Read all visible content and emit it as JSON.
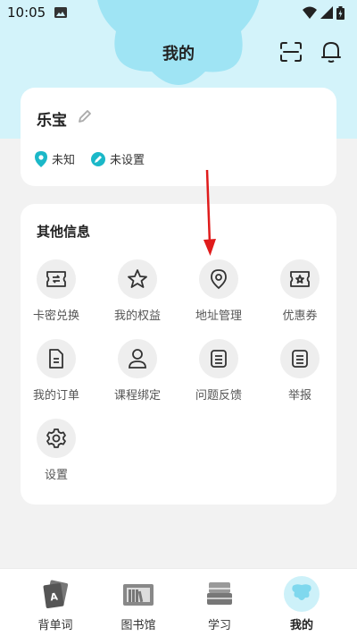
{
  "status_bar": {
    "time": "10:05"
  },
  "header": {
    "title": "我的"
  },
  "profile": {
    "name": "乐宝",
    "location": "未知",
    "setting": "未设置"
  },
  "other_info": {
    "title": "其他信息",
    "items": [
      {
        "label": "卡密兑换",
        "icon": "ticket-exchange-icon"
      },
      {
        "label": "我的权益",
        "icon": "star-icon"
      },
      {
        "label": "地址管理",
        "icon": "location-pin-icon"
      },
      {
        "label": "优惠券",
        "icon": "coupon-icon"
      },
      {
        "label": "我的订单",
        "icon": "order-document-icon"
      },
      {
        "label": "课程绑定",
        "icon": "person-icon"
      },
      {
        "label": "问题反馈",
        "icon": "feedback-document-icon"
      },
      {
        "label": "举报",
        "icon": "report-document-icon"
      },
      {
        "label": "设置",
        "icon": "gear-icon"
      }
    ]
  },
  "bottom_nav": {
    "items": [
      {
        "label": "背单词",
        "icon": "flashcard-icon"
      },
      {
        "label": "图书馆",
        "icon": "bookshelf-icon"
      },
      {
        "label": "学习",
        "icon": "book-stack-icon"
      },
      {
        "label": "我的",
        "icon": "avatar-cloud-icon",
        "active": true
      }
    ]
  },
  "colors": {
    "header_bg": "#d3f3fa",
    "accent": "#1bb8c8",
    "annotation_arrow": "#e01b1b"
  }
}
